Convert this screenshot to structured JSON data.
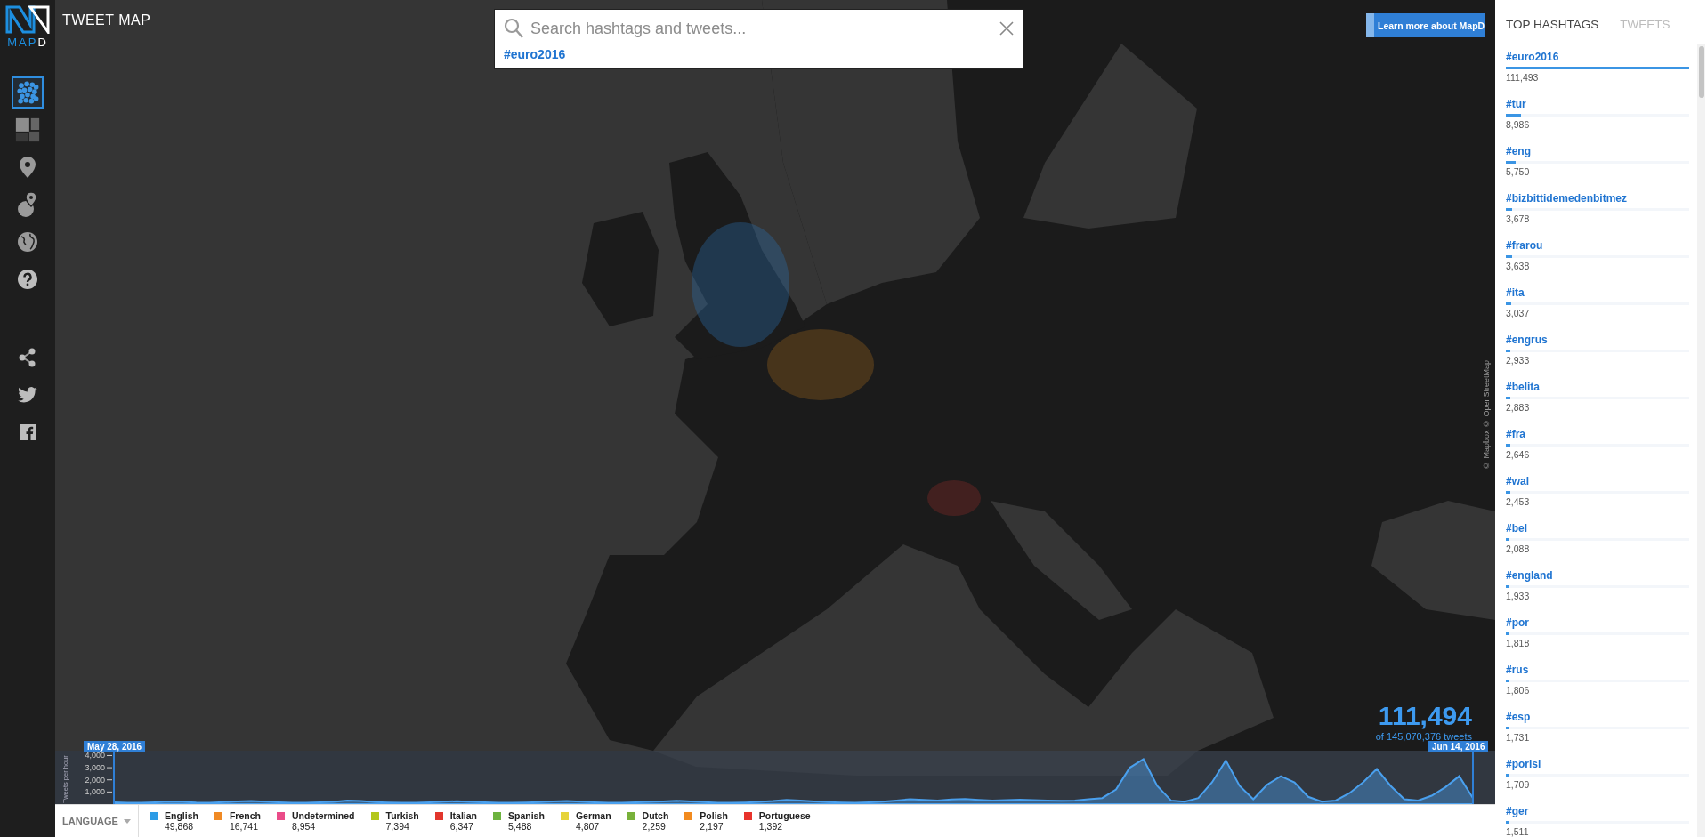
{
  "app": {
    "logo_parts": [
      "MAP",
      "D"
    ],
    "title": "TWEET MAP"
  },
  "sidebar": {
    "tools": [
      {
        "kind": "points",
        "selected": true
      },
      {
        "kind": "heatmap",
        "selected": false
      },
      {
        "kind": "pin",
        "selected": false
      },
      {
        "kind": "pin_radius",
        "selected": false
      },
      {
        "kind": "globe",
        "selected": false
      },
      {
        "kind": "help",
        "selected": false
      }
    ],
    "social": [
      {
        "kind": "share"
      },
      {
        "kind": "twitter"
      },
      {
        "kind": "facebook"
      }
    ]
  },
  "search": {
    "placeholder": "Search hashtags and tweets...",
    "filters": [
      "#euro2016"
    ]
  },
  "learn_more_button": "Learn more about MapD",
  "map": {
    "kind": "picture",
    "attribution": "© Mapbox © OpenStreetMap"
  },
  "counter": {
    "value": "111,494",
    "total": "of 145,070,376 tweets"
  },
  "timeline": {
    "start_label": "May 28, 2016",
    "end_label": "Jun 14, 2016",
    "chart_data": {
      "type": "area",
      "categories": [
        null,
        null,
        null,
        null,
        null,
        null,
        null,
        null,
        null,
        null,
        null,
        null,
        null,
        null,
        null,
        null,
        null,
        null,
        null,
        null,
        null,
        null,
        null,
        null,
        null,
        null,
        null,
        null,
        null,
        null,
        null,
        null,
        null,
        null,
        null,
        null,
        null,
        null,
        null,
        null,
        null,
        null,
        null,
        null,
        null,
        null,
        null,
        null,
        null,
        null,
        null,
        null,
        null,
        null,
        null,
        null,
        null,
        null,
        null,
        null,
        null,
        null,
        null,
        null,
        null,
        null,
        null,
        null,
        null,
        null,
        null,
        null,
        null,
        null,
        null,
        null,
        null,
        null,
        null,
        null,
        null,
        null,
        null,
        null,
        null,
        null,
        null,
        null,
        null,
        null,
        null,
        null,
        null,
        null,
        null,
        null,
        null,
        null,
        null,
        null
      ],
      "ylabel": "Tweets per hour",
      "ylim": [
        0,
        4400
      ],
      "yticks": [
        {
          "value": 1000,
          "label": "1,000"
        },
        {
          "value": 2000,
          "label": "2,000"
        },
        {
          "value": 3000,
          "label": "3,000"
        },
        {
          "value": 4000,
          "label": "4,000"
        }
      ],
      "series": [
        {
          "color": "#4aa0ee",
          "values": [
            150,
            120,
            100,
            140,
            200,
            180,
            130,
            110,
            160,
            220,
            260,
            200,
            150,
            120,
            100,
            140,
            180,
            300,
            250,
            160,
            130,
            120,
            110,
            150,
            200,
            240,
            180,
            140,
            120,
            100,
            130,
            170,
            220,
            260,
            200,
            150,
            120,
            110,
            140,
            190,
            230,
            280,
            220,
            160,
            120,
            100,
            130,
            180,
            250,
            350,
            300,
            220,
            160,
            130,
            120,
            150,
            200,
            300,
            400,
            350,
            300,
            380,
            420,
            350,
            300,
            320,
            360,
            330,
            300,
            280,
            300,
            400,
            500,
            1200,
            3000,
            3700,
            1500,
            300,
            200,
            500,
            1800,
            3600,
            1500,
            400,
            1600,
            2300,
            1800,
            600,
            200,
            300,
            900,
            1800,
            2900,
            1500,
            400,
            300,
            700,
            1400,
            2300,
            500
          ]
        }
      ]
    }
  },
  "legend": {
    "title": "LANGUAGE",
    "items": [
      {
        "name": "English",
        "count": "49,868",
        "color": "#2d9ce6"
      },
      {
        "name": "French",
        "count": "16,741",
        "color": "#f08a24"
      },
      {
        "name": "Undetermined",
        "count": "8,954",
        "color": "#ea4c89"
      },
      {
        "name": "Turkish",
        "count": "7,394",
        "color": "#b3c71c"
      },
      {
        "name": "Italian",
        "count": "6,347",
        "color": "#e2362d"
      },
      {
        "name": "Spanish",
        "count": "5,488",
        "color": "#6db33f"
      },
      {
        "name": "German",
        "count": "4,807",
        "color": "#e6d33a"
      },
      {
        "name": "Dutch",
        "count": "2,259",
        "color": "#78b13a"
      },
      {
        "name": "Polish",
        "count": "2,197",
        "color": "#f28b1f"
      },
      {
        "name": "Portuguese",
        "count": "1,392",
        "color": "#e8332c"
      }
    ]
  },
  "panel": {
    "tabs": [
      {
        "label": "TOP HASHTAGS",
        "selected": true
      },
      {
        "label": "TWEETS",
        "selected": false
      }
    ],
    "hashtags": [
      {
        "tag": "#euro2016",
        "count": "111,493",
        "level": 1
      },
      {
        "tag": "#tur",
        "count": "8,986",
        "level": 0.081
      },
      {
        "tag": "#eng",
        "count": "5,750",
        "level": 0.052
      },
      {
        "tag": "#bizbittidemedenbitmez",
        "count": "3,678",
        "level": 0.033
      },
      {
        "tag": "#frarou",
        "count": "3,638",
        "level": 0.033
      },
      {
        "tag": "#ita",
        "count": "3,037",
        "level": 0.027
      },
      {
        "tag": "#engrus",
        "count": "2,933",
        "level": 0.026
      },
      {
        "tag": "#belita",
        "count": "2,883",
        "level": 0.026
      },
      {
        "tag": "#fra",
        "count": "2,646",
        "level": 0.024
      },
      {
        "tag": "#wal",
        "count": "2,453",
        "level": 0.022
      },
      {
        "tag": "#bel",
        "count": "2,088",
        "level": 0.019
      },
      {
        "tag": "#england",
        "count": "1,933",
        "level": 0.017
      },
      {
        "tag": "#por",
        "count": "1,818",
        "level": 0.016
      },
      {
        "tag": "#rus",
        "count": "1,806",
        "level": 0.016
      },
      {
        "tag": "#esp",
        "count": "1,731",
        "level": 0.016
      },
      {
        "tag": "#porisl",
        "count": "1,709",
        "level": 0.015
      },
      {
        "tag": "#ger",
        "count": "1,511",
        "level": 0.014
      }
    ]
  }
}
